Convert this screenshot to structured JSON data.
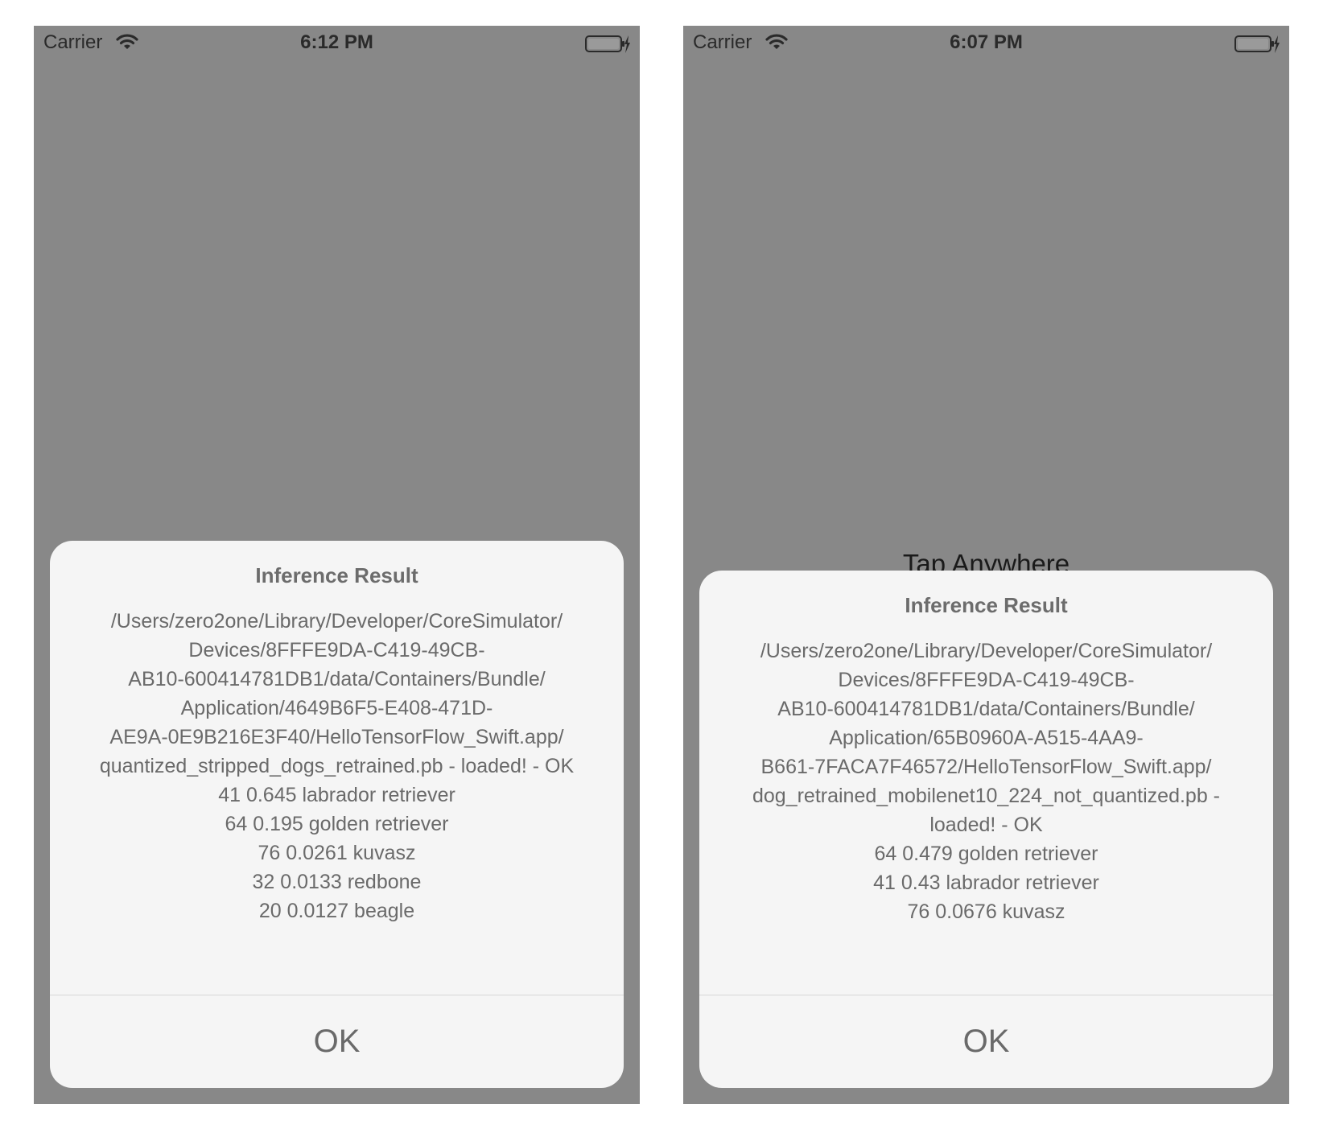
{
  "screens": [
    {
      "status_bar": {
        "carrier": "Carrier",
        "time": "6:12 PM"
      },
      "alert": {
        "title": "Inference Result",
        "message": "/Users/zero2one/Library/Developer/CoreSimulator/\nDevices/8FFFE9DA-C419-49CB-\nAB10-600414781DB1/data/Containers/Bundle/\nApplication/4649B6F5-E408-471D-\nAE9A-0E9B216E3F40/HelloTensorFlow_Swift.app/\nquantized_stripped_dogs_retrained.pb - loaded! - OK\n41 0.645  labrador retriever\n64 0.195  golden retriever\n76 0.0261  kuvasz\n32 0.0133  redbone\n20 0.0127  beagle",
        "button_label": "OK"
      }
    },
    {
      "status_bar": {
        "carrier": "Carrier",
        "time": "6:07 PM"
      },
      "background_label": "Tap Anywhere",
      "alert": {
        "title": "Inference Result",
        "message": "/Users/zero2one/Library/Developer/CoreSimulator/\nDevices/8FFFE9DA-C419-49CB-\nAB10-600414781DB1/data/Containers/Bundle/\nApplication/65B0960A-A515-4AA9-\nB661-7FACA7F46572/HelloTensorFlow_Swift.app/\ndog_retrained_mobilenet10_224_not_quantized.pb -\nloaded! - OK\n64 0.479  golden retriever\n41 0.43  labrador retriever\n76 0.0676  kuvasz",
        "button_label": "OK"
      }
    }
  ],
  "icons": [
    "wifi-icon",
    "battery-charging-icon"
  ]
}
